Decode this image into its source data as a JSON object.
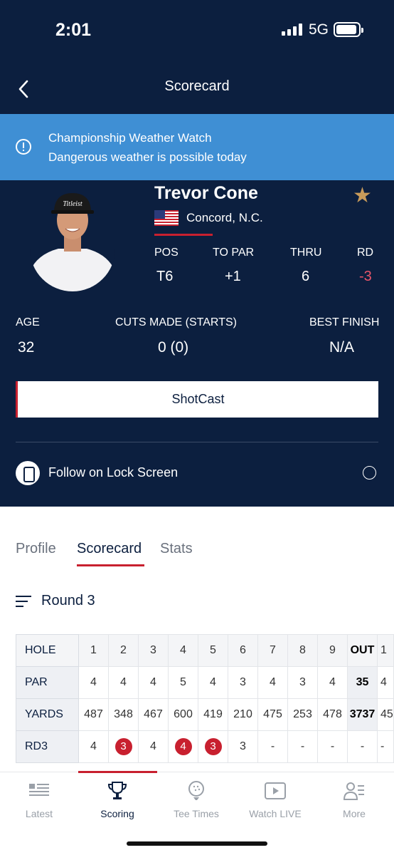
{
  "status_bar": {
    "time": "2:01",
    "network": "5G"
  },
  "header": {
    "title": "Scorecard"
  },
  "alert": {
    "title": "Championship Weather Watch",
    "message": "Dangerous weather is possible today"
  },
  "player": {
    "name": "Trevor Cone",
    "location": "Concord, N.C.",
    "stats": [
      {
        "label": "POS",
        "value": "T6"
      },
      {
        "label": "TO PAR",
        "value": "+1"
      },
      {
        "label": "THRU",
        "value": "6"
      },
      {
        "label": "RD",
        "value": "-3"
      }
    ],
    "age_label": "AGE",
    "age": "32",
    "cuts_label": "CUTS MADE (STARTS)",
    "cuts": "0 (0)",
    "best_label": "BEST FINISH",
    "best": "N/A",
    "accent_color": "#c8202f"
  },
  "shotcast_label": "ShotCast",
  "lock_screen_label": "Follow on Lock Screen",
  "tabs": [
    {
      "label": "Profile"
    },
    {
      "label": "Scorecard"
    },
    {
      "label": "Stats"
    }
  ],
  "round_label": "Round 3",
  "scorecard": {
    "rows": [
      {
        "label": "HOLE",
        "cells": [
          "1",
          "2",
          "3",
          "4",
          "5",
          "6",
          "7",
          "8",
          "9",
          "OUT",
          "1"
        ]
      },
      {
        "label": "PAR",
        "cells": [
          "4",
          "4",
          "4",
          "5",
          "4",
          "3",
          "4",
          "3",
          "4",
          "35",
          "4"
        ]
      },
      {
        "label": "YARDS",
        "cells": [
          "487",
          "348",
          "467",
          "600",
          "419",
          "210",
          "475",
          "253",
          "478",
          "3737",
          "45"
        ]
      },
      {
        "label": "RD3",
        "cells": [
          "4",
          "3",
          "4",
          "4",
          "3",
          "3",
          "-",
          "-",
          "-",
          "-",
          "-"
        ]
      }
    ]
  },
  "bottom_nav": [
    {
      "label": "Latest",
      "icon": "news-icon"
    },
    {
      "label": "Scoring",
      "icon": "trophy-icon"
    },
    {
      "label": "Tee Times",
      "icon": "golf-ball-icon"
    },
    {
      "label": "Watch LIVE",
      "icon": "play-icon"
    },
    {
      "label": "More",
      "icon": "profile-list-icon"
    }
  ]
}
